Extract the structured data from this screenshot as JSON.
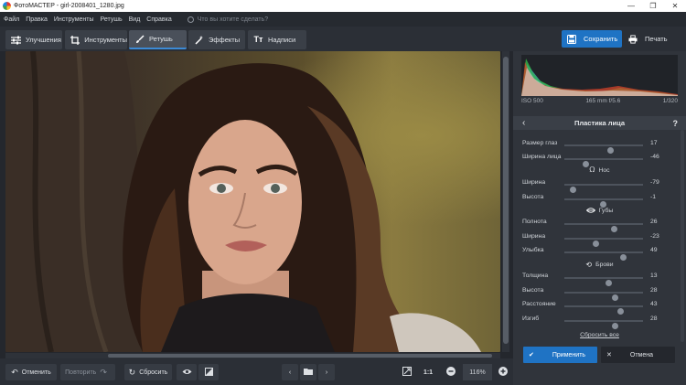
{
  "window": {
    "title": "ФотоМАСТЕР - girl-2008401_1280.jpg",
    "controls": {
      "minimize": "—",
      "maximize": "❐",
      "close": "✕"
    }
  },
  "menu": {
    "items": [
      "Файл",
      "Правка",
      "Инструменты",
      "Ретушь",
      "Вид",
      "Справка"
    ],
    "search_placeholder": "Что вы хотите сделать?"
  },
  "toolbar": {
    "tabs": [
      {
        "label": "Улучшения",
        "icon": "sliders-icon",
        "active": false
      },
      {
        "label": "Инструменты",
        "icon": "crop-icon",
        "active": false
      },
      {
        "label": "Ретушь",
        "icon": "brush-icon",
        "active": true
      },
      {
        "label": "Эффекты",
        "icon": "magic-wand-icon",
        "active": false
      },
      {
        "label": "Надписи",
        "icon": "text-icon",
        "active": false
      }
    ],
    "save_label": "Сохранить",
    "print_label": "Печать"
  },
  "bottom": {
    "undo_label": "Отменить",
    "redo_label": "Повторить",
    "reset_label": "Сбросить",
    "ratio_label": "1:1",
    "zoom_value": "116%"
  },
  "panel": {
    "histogram_info": {
      "iso": "ISO 500",
      "lens": "165 mm f/5.6",
      "shutter": "1/320"
    },
    "title": "Пластика лица",
    "help": "?",
    "eyes": [
      {
        "label": "Размер глаз",
        "value": "17",
        "position": 0.58
      },
      {
        "label": "Ширина лица",
        "value": "-46",
        "position": 0.27
      }
    ],
    "nose": {
      "title": "Нос",
      "rows": [
        {
          "label": "Ширина",
          "value": "-79",
          "position": 0.1
        },
        {
          "label": "Высота",
          "value": "-1",
          "position": 0.49
        }
      ]
    },
    "lips": {
      "title": "Губы",
      "rows": [
        {
          "label": "Полнота",
          "value": "26",
          "position": 0.63
        },
        {
          "label": "Ширина",
          "value": "-23",
          "position": 0.39
        },
        {
          "label": "Улыбка",
          "value": "49",
          "position": 0.74
        }
      ]
    },
    "brows": {
      "title": "Брови",
      "rows": [
        {
          "label": "Толщина",
          "value": "13",
          "position": 0.56
        },
        {
          "label": "Высота",
          "value": "28",
          "position": 0.64
        },
        {
          "label": "Расстояние",
          "value": "43",
          "position": 0.71
        },
        {
          "label": "Изгиб",
          "value": "28",
          "position": 0.64
        }
      ]
    },
    "reset_all": "Сбросить все",
    "apply_label": "Применить",
    "cancel_label": "Отмена"
  },
  "colors": {
    "accent": "#1f73c4",
    "panel_bg": "#30343b",
    "toolbar_bg": "#2b2f36"
  }
}
